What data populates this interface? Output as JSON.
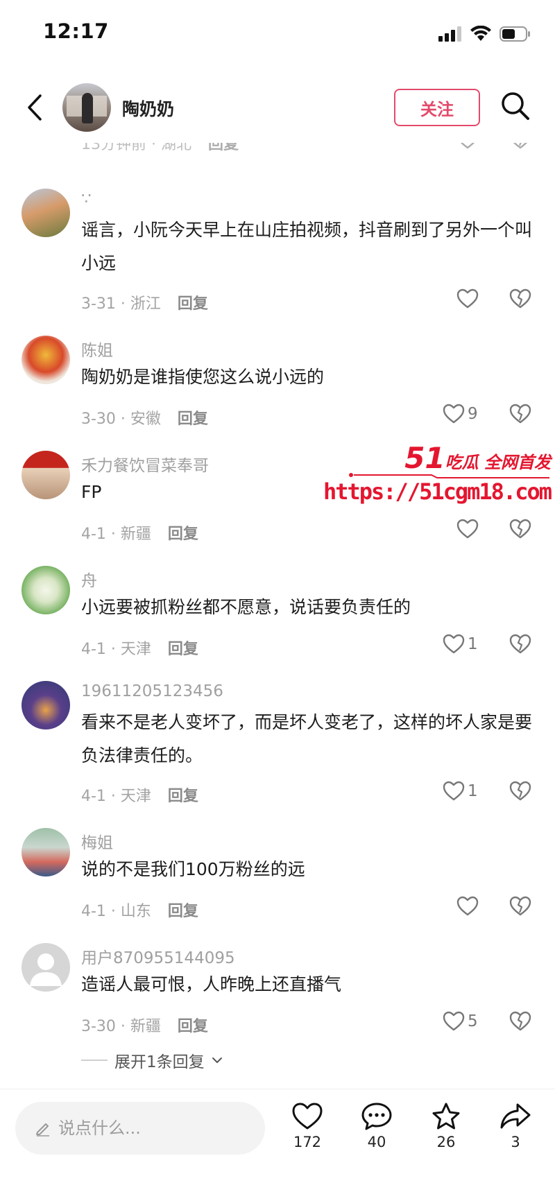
{
  "status_bar": {
    "time": "12:17"
  },
  "header": {
    "author": "陶奶奶",
    "follow_label": "关注"
  },
  "partial_comment": {
    "meta": "13分钟前 · 湖北",
    "reply": "回复"
  },
  "comments": [
    {
      "name": "∵",
      "text": "谣言，小阮今天早上在山庄拍视频，抖音刷到了另外一个叫小远",
      "meta": "3-31 · 浙江",
      "reply": "回复",
      "likes": ""
    },
    {
      "name": "陈姐",
      "text": "陶奶奶是谁指使您这么说小远的",
      "meta": "3-30 · 安徽",
      "reply": "回复",
      "likes": "9"
    },
    {
      "name": "禾力餐饮冒菜奉哥",
      "text": "FP",
      "meta": "4-1 · 新疆",
      "reply": "回复",
      "likes": ""
    },
    {
      "name": "舟",
      "text": "小远要被抓粉丝都不愿意，说话要负责任的",
      "meta": "4-1 · 天津",
      "reply": "回复",
      "likes": "1"
    },
    {
      "name": "19611205123456",
      "text": "看来不是老人变坏了，而是坏人变老了，这样的坏人家是要负法律责任的。",
      "meta": "4-1 · 天津",
      "reply": "回复",
      "likes": "1"
    },
    {
      "name": "梅姐",
      "text": "说的不是我们100万粉丝的远",
      "meta": "4-1 · 山东",
      "reply": "回复",
      "likes": ""
    },
    {
      "name": "用户870955144095",
      "text": "造谣人最可恨，人昨晚上还直播气",
      "meta": "3-30 · 新疆",
      "reply": "回复",
      "likes": "5"
    }
  ],
  "expand_replies": "展开1条回复",
  "watermark": {
    "brand_num": "51",
    "brand_text": "吃瓜 全网首发",
    "url": "https://51cgm18.com"
  },
  "bottom_bar": {
    "input_placeholder": "说点什么...",
    "likes": "172",
    "comments": "40",
    "favorites": "26",
    "shares": "3"
  },
  "colors": {
    "accent": "#e34a6a",
    "watermark": "#e4162f"
  },
  "icons": [
    "back-icon",
    "search-icon",
    "heart-icon",
    "heart-broken-icon",
    "chat-bubble-icon",
    "star-icon",
    "share-icon",
    "pencil-icon",
    "chevron-down-icon"
  ]
}
